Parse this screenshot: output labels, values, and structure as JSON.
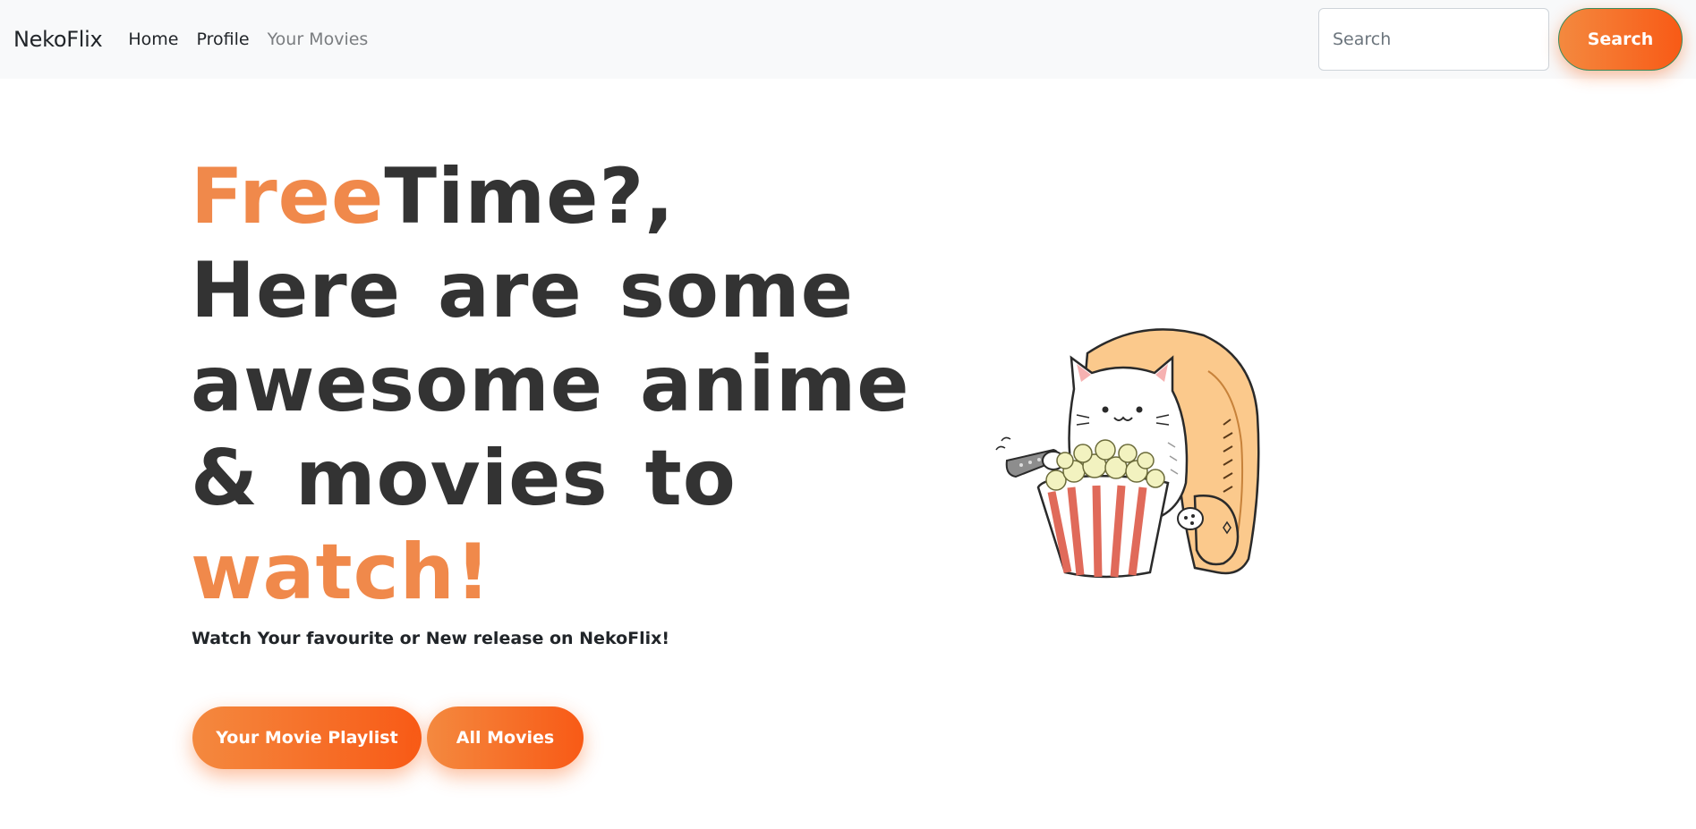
{
  "navbar": {
    "brand": "NekoFlix",
    "links": [
      {
        "label": "Home"
      },
      {
        "label": "Profile"
      },
      {
        "label": "Your Movies"
      }
    ],
    "search": {
      "placeholder": "Search",
      "value": "",
      "button_label": "Search"
    }
  },
  "hero": {
    "title": {
      "line1_accent": "Free",
      "line1_rest": "Time?,",
      "line2": "Here are some",
      "line3": "awesome anime",
      "line4": "& movies to",
      "line5_accent": "watch!"
    },
    "subtitle": "Watch Your favourite or New release on NekoFlix!",
    "buttons": {
      "playlist": "Your Movie Playlist",
      "all_movies": "All Movies"
    },
    "illustration": "cat-eating-popcorn-illustration"
  },
  "colors": {
    "accent_text": "#f0894b",
    "button_gradient_start": "#f4893f",
    "button_gradient_end": "#f85a16",
    "navbar_bg": "#f8f9fa",
    "heading_text": "#333333"
  }
}
